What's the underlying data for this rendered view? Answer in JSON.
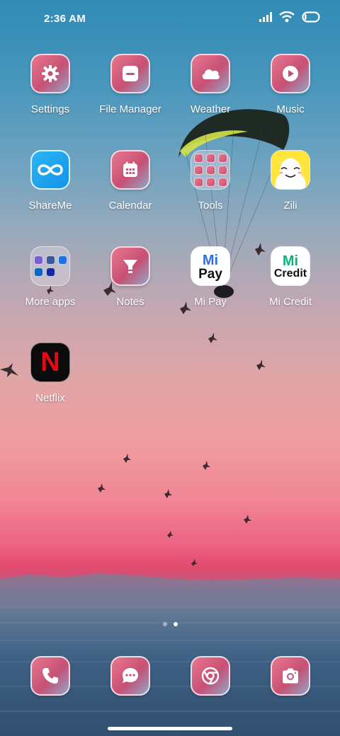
{
  "status_bar": {
    "time": "2:36 AM",
    "icons": [
      "cellular-signal-icon",
      "wifi-icon",
      "battery-icon"
    ]
  },
  "apps": {
    "settings": "Settings",
    "file_manager": "File Manager",
    "weather": "Weather",
    "music": "Music",
    "shareme": "ShareMe",
    "calendar": "Calendar",
    "tools": "Tools",
    "zili": "Zili",
    "more_apps": "More apps",
    "notes": "Notes",
    "mi_pay": "Mi Pay",
    "mi_credit": "Mi Credit",
    "netflix": "Netflix"
  },
  "icon_text": {
    "mi_pay_top": "Mi",
    "mi_pay_bottom": "Pay",
    "mi_credit_top": "Mi",
    "mi_credit_bottom": "Credit",
    "netflix_letter": "N"
  },
  "dock": {
    "items": [
      "phone-icon",
      "messaging-icon",
      "chrome-icon",
      "camera-icon"
    ]
  },
  "pagination": {
    "pages": 2,
    "current": 2
  },
  "colors": {
    "theme_pink": "#c75074",
    "shareme_blue": "#1aa3f0",
    "zili_yellow": "#ffe53d",
    "mi_green": "#10b27a",
    "mi_blue": "#2f6fe0",
    "netflix_red": "#e50914"
  }
}
